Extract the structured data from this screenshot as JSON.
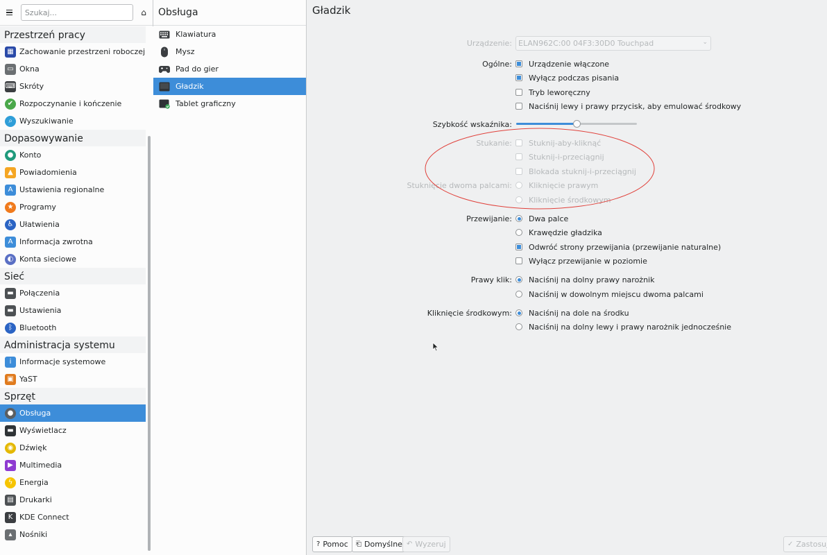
{
  "sidebar": {
    "search_placeholder": "Szukaj...",
    "categories": [
      {
        "title": "Przestrzeń pracy",
        "items": [
          {
            "label": "Zachowanie przestrzeni roboczej",
            "icon": "workspace-icon",
            "color": "#2a4aa8"
          },
          {
            "label": "Okna",
            "icon": "windows-icon",
            "color": "#6b6f72"
          },
          {
            "label": "Skróty",
            "icon": "keyboard-shortcuts-icon",
            "color": "#3b3e41"
          },
          {
            "label": "Rozpoczynanie i kończenie",
            "icon": "startup-icon",
            "color": "#4aa84a"
          },
          {
            "label": "Wyszukiwanie",
            "icon": "search-icon",
            "color": "#2f9ed8"
          }
        ]
      },
      {
        "title": "Dopasowywanie",
        "items": [
          {
            "label": "Konto",
            "icon": "account-icon",
            "color": "#1f9a7c"
          },
          {
            "label": "Powiadomienia",
            "icon": "bell-icon",
            "color": "#f5a623"
          },
          {
            "label": "Ustawienia regionalne",
            "icon": "regional-icon",
            "color": "#3d8dd9"
          },
          {
            "label": "Programy",
            "icon": "applications-icon",
            "color": "#f07a1c"
          },
          {
            "label": "Ułatwienia",
            "icon": "accessibility-icon",
            "color": "#2b64c4"
          },
          {
            "label": "Informacja zwrotna",
            "icon": "feedback-icon",
            "color": "#3d8dd9"
          },
          {
            "label": "Konta sieciowe",
            "icon": "online-accounts-icon",
            "color": "#5a6fc4"
          }
        ]
      },
      {
        "title": "Sieć",
        "items": [
          {
            "label": "Połączenia",
            "icon": "connections-icon",
            "color": "#4d5154"
          },
          {
            "label": "Ustawienia",
            "icon": "network-settings-icon",
            "color": "#4d5154"
          },
          {
            "label": "Bluetooth",
            "icon": "bluetooth-icon",
            "color": "#2b64c4"
          }
        ]
      },
      {
        "title": "Administracja systemu",
        "items": [
          {
            "label": "Informacje systemowe",
            "icon": "info-icon",
            "color": "#3d8dd9"
          },
          {
            "label": "YaST",
            "icon": "yast-icon",
            "color": "#e07b1e"
          }
        ]
      },
      {
        "title": "Sprzęt",
        "items": [
          {
            "label": "Obsługa",
            "icon": "input-devices-icon",
            "color": "#5b5f62",
            "selected": true
          },
          {
            "label": "Wyświetlacz",
            "icon": "display-icon",
            "color": "#2f3336"
          },
          {
            "label": "Dźwięk",
            "icon": "audio-icon",
            "color": "#e4b800"
          },
          {
            "label": "Multimedia",
            "icon": "multimedia-icon",
            "color": "#8e3bd1"
          },
          {
            "label": "Energia",
            "icon": "energy-icon",
            "color": "#f6c400"
          },
          {
            "label": "Drukarki",
            "icon": "printer-icon",
            "color": "#4d5154"
          },
          {
            "label": "KDE Connect",
            "icon": "kde-connect-icon",
            "color": "#3b3e41"
          },
          {
            "label": "Nośniki",
            "icon": "removable-storage-icon",
            "color": "#6b6f72"
          }
        ]
      }
    ]
  },
  "middle": {
    "title": "Obsługa",
    "items": [
      {
        "label": "Klawiatura",
        "icon": "keyboard-icon"
      },
      {
        "label": "Mysz",
        "icon": "mouse-icon"
      },
      {
        "label": "Pad do gier",
        "icon": "gamepad-icon"
      },
      {
        "label": "Gładzik",
        "icon": "touchpad-icon",
        "selected": true
      },
      {
        "label": "Tablet graficzny",
        "icon": "tablet-icon"
      }
    ]
  },
  "main": {
    "title": "Gładzik",
    "device_label": "Urządzenie:",
    "device_value": "ELAN962C:00 04F3:30D0 Touchpad",
    "general_label": "Ogólne:",
    "general_options": [
      {
        "label": "Urządzenie włączone",
        "checked": true
      },
      {
        "label": "Wyłącz podczas pisania",
        "checked": true
      },
      {
        "label": "Tryb leworęczny",
        "checked": false
      },
      {
        "label": "Naciśnij lewy i prawy przycisk, aby emulować środkowy",
        "checked": false
      }
    ],
    "speed_label": "Szybkość wskaźnika:",
    "speed_value": 0.5,
    "tapping_label": "Stukanie:",
    "tapping_options": [
      {
        "label": "Stuknij-aby-kliknąć",
        "checked": false
      },
      {
        "label": "Stuknij-i-przeciągnij",
        "checked": false
      },
      {
        "label": "Blokada stuknij-i-przeciągnij",
        "checked": false
      }
    ],
    "two_finger_label": "Stuknięcie dwoma palcami:",
    "two_finger_options": [
      {
        "label": "Kliknięcie prawym",
        "checked": false
      },
      {
        "label": "Kliknięcie środkowym",
        "checked": false
      }
    ],
    "scrolling_label": "Przewijanie:",
    "scrolling_radios": [
      {
        "label": "Dwa palce",
        "checked": true
      },
      {
        "label": "Krawędzie gładzika",
        "checked": false
      }
    ],
    "scrolling_checks": [
      {
        "label": "Odwróć strony przewijania (przewijanie naturalne)",
        "checked": true
      },
      {
        "label": "Wyłącz przewijanie w poziomie",
        "checked": false
      }
    ],
    "right_click_label": "Prawy klik:",
    "right_click_options": [
      {
        "label": "Naciśnij na dolny prawy narożnik",
        "checked": true
      },
      {
        "label": "Naciśnij w dowolnym miejscu dwoma palcami",
        "checked": false
      }
    ],
    "middle_click_label": "Kliknięcie środkowym:",
    "middle_click_options": [
      {
        "label": "Naciśnij na dole na środku",
        "checked": true
      },
      {
        "label": "Naciśnij na dolny lewy i prawy narożnik jednocześnie",
        "checked": false
      }
    ],
    "annotation_color": "#e0403a"
  },
  "buttons": {
    "help": "Pomoc",
    "defaults": "Domyślne",
    "reset": "Wyzeruj",
    "apply": "Zastosuj"
  },
  "colors": {
    "accent": "#3d8dd9",
    "window_bg": "#eff0f1",
    "view_bg": "#fcfcfc"
  }
}
